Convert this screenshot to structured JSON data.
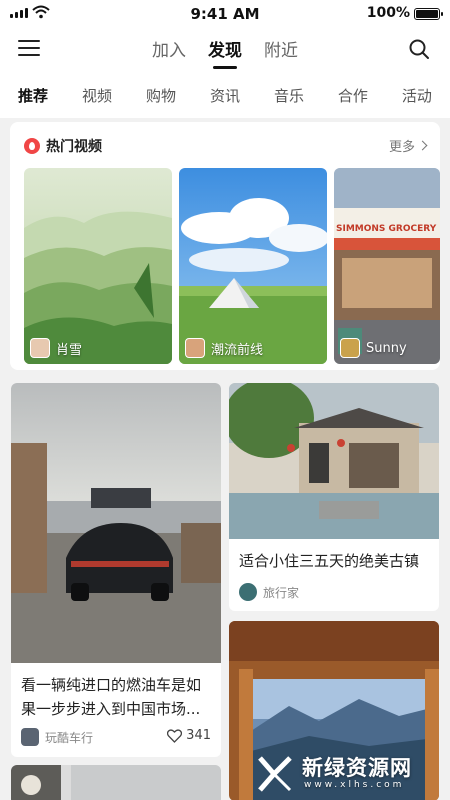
{
  "status_bar": {
    "time": "9:41 AM",
    "battery_text": "100%",
    "battery_level": 1.0
  },
  "top_nav": {
    "tabs": [
      {
        "label": "加入",
        "active": false
      },
      {
        "label": "发现",
        "active": true
      },
      {
        "label": "附近",
        "active": false
      }
    ],
    "icons": {
      "left": "menu-icon",
      "right": "search-icon"
    }
  },
  "categories": [
    "推荐",
    "视频",
    "购物",
    "资讯",
    "音乐",
    "合作",
    "活动"
  ],
  "hot_videos": {
    "title": "热门视频",
    "more": "更多",
    "items": [
      {
        "author": "肖雪"
      },
      {
        "author": "潮流前线"
      },
      {
        "author": "Sunny",
        "sign_text": "SIMMONS GROCERY"
      }
    ]
  },
  "feed": [
    {
      "title": "看一辆纯进口的燃油车是如果一步步进入到中国市场...",
      "title_line1": "看一辆纯进口的燃油车是如",
      "title_line2": "果一步步进入到中国市场...",
      "author": "玩酷车行",
      "likes": "341"
    },
    {
      "title": "适合小住三五天的绝美古镇",
      "author": "旅行家"
    }
  ],
  "watermark": {
    "name": "新绿资源网",
    "url": "www.xlhs.com"
  },
  "colors": {
    "accent_red": "#f04646",
    "text_dark": "#111111",
    "text_muted": "#888888"
  }
}
